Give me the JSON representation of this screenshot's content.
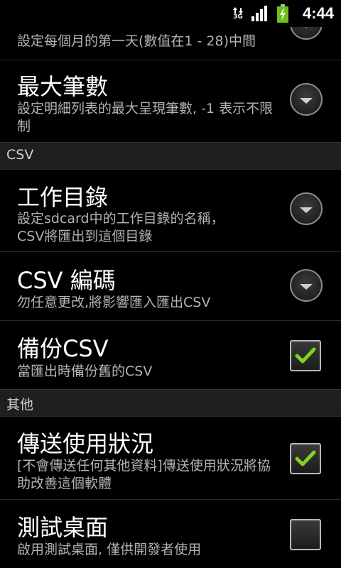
{
  "status_bar": {
    "network_type": "3G",
    "time": "4:44",
    "icons": [
      "data-arrows-icon",
      "signal-icon",
      "battery-charging-icon"
    ]
  },
  "settings": {
    "partial_row": {
      "subtitle": "設定每個月的第一天(數值在1 - 28)中間"
    },
    "max_records": {
      "title": "最大筆數",
      "subtitle": "設定明細列表的最大呈現筆數, -1 表示不限制"
    },
    "csv_header": "CSV",
    "work_dir": {
      "title": "工作目錄",
      "subtitle": "設定sdcard中的工作目錄的名稱，CSV將匯出到這個目錄"
    },
    "csv_encoding": {
      "title": "CSV 編碼",
      "subtitle": "勿任意更改,將影響匯入匯出CSV"
    },
    "backup_csv": {
      "title": "備份CSV",
      "subtitle": "當匯出時備份舊的CSV",
      "checked": true
    },
    "other_header": "其他",
    "send_usage": {
      "title": "傳送使用狀況",
      "subtitle": "[不會傳送任何其他資料]傳送使用狀況將協助改善這個軟體",
      "checked": true
    },
    "test_desktop": {
      "title": "測試桌面",
      "subtitle": "啟用測試桌面, 僅供開發者使用",
      "checked": false
    }
  },
  "colors": {
    "check_green": "#7ed321",
    "header_bg": "#1f1f1f",
    "subtitle": "#b3b3b3"
  }
}
